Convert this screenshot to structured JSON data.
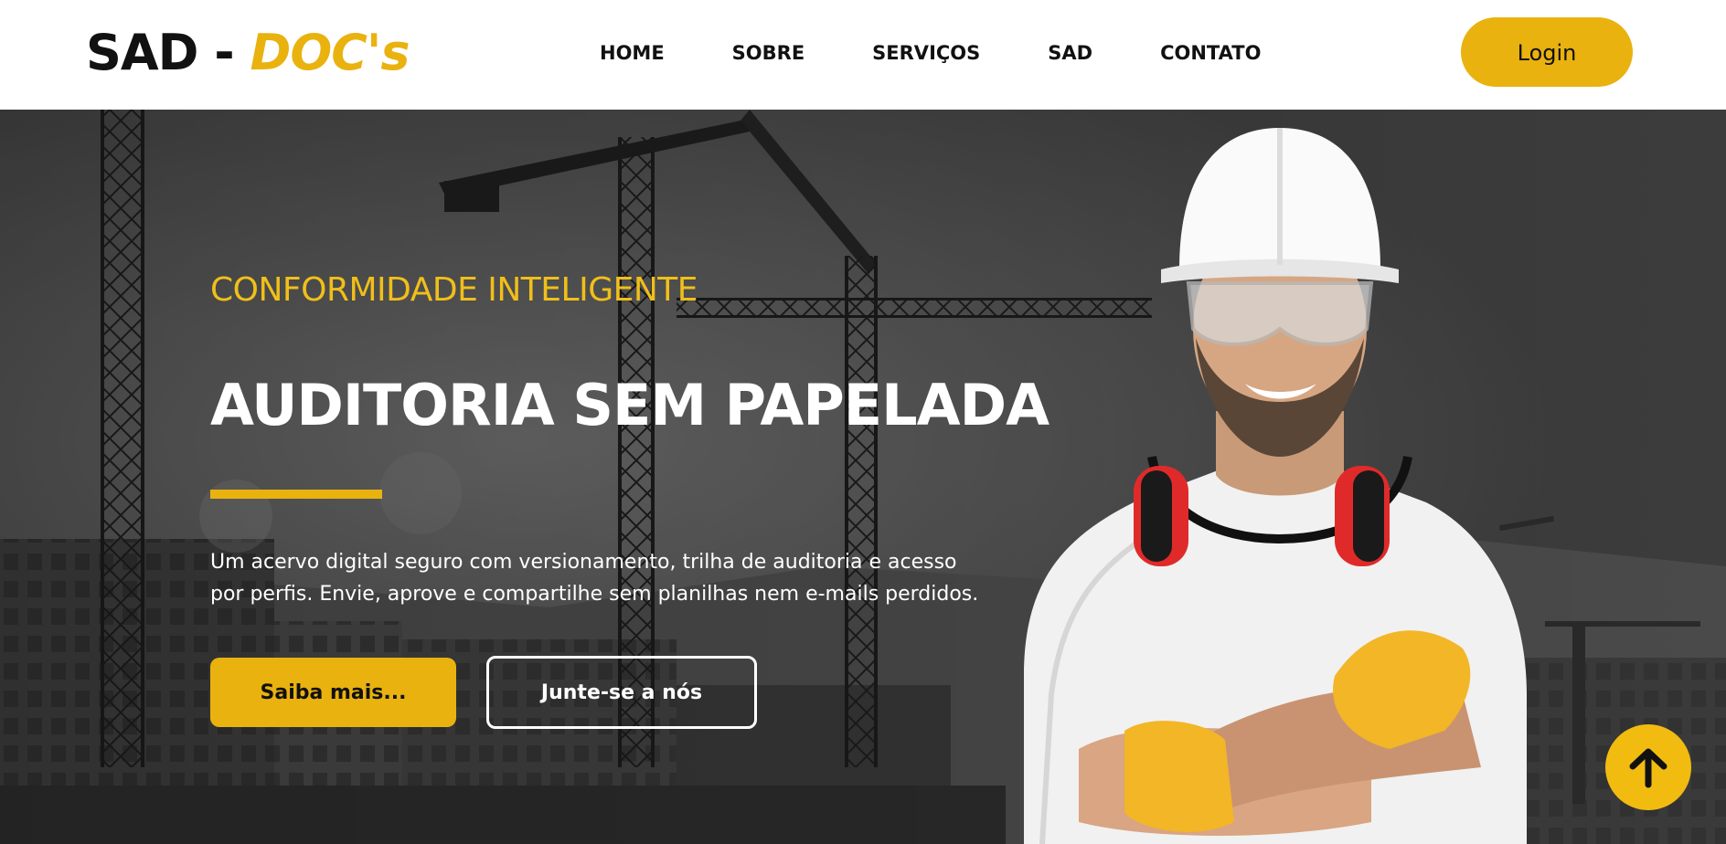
{
  "header": {
    "logo": {
      "part1": "SAD - ",
      "part2": "DOC's"
    },
    "nav": [
      "HOME",
      "SOBRE",
      "SERVIÇOS",
      "SAD",
      "CONTATO"
    ],
    "login_label": "Login"
  },
  "hero": {
    "kicker": "CONFORMIDADE INTELIGENTE",
    "headline": "AUDITORIA SEM PAPELADA",
    "description": "Um acervo digital seguro com versionamento, trilha de auditoria e acesso por perfis. Envie, aprove e compartilhe sem planilhas nem e-mails perdidos.",
    "primary_button": "Saiba mais...",
    "secondary_button": "Junte-se a nós"
  },
  "scroll_top_icon": "arrow-up-icon",
  "colors": {
    "accent": "#e9b20f",
    "header_bg": "#ffffff",
    "text_dark": "#111111",
    "hero_text": "#ffffff"
  }
}
